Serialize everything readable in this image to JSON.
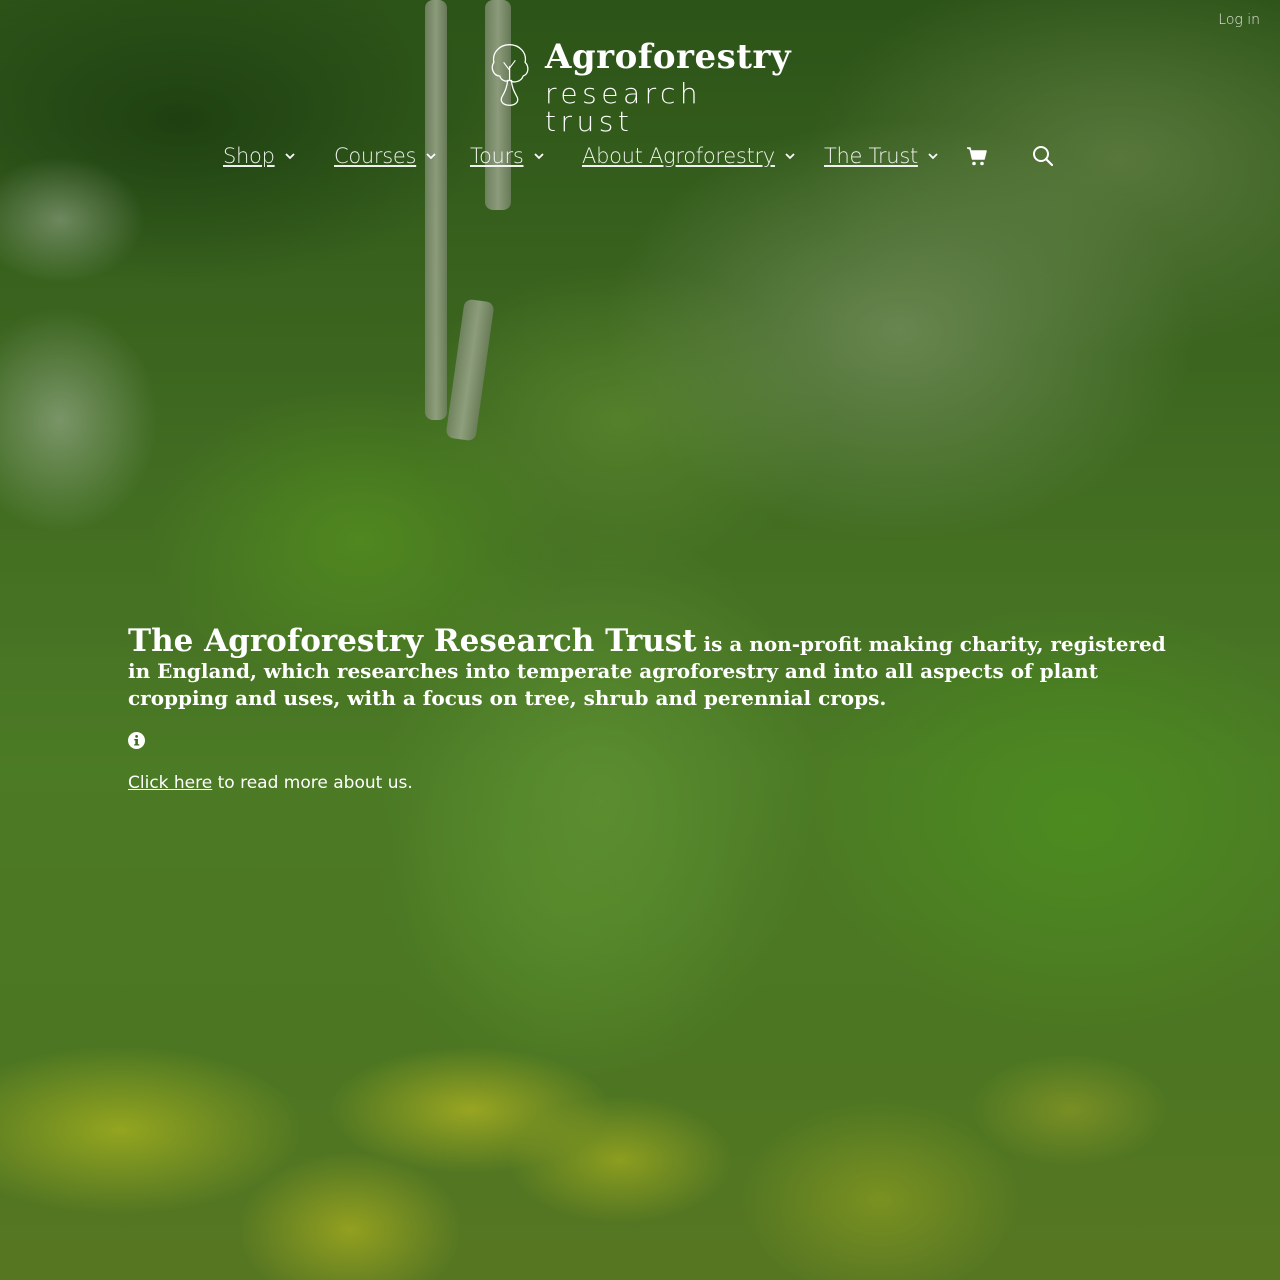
{
  "header": {
    "login_label": "Log in",
    "logo": {
      "title": "Agroforestry",
      "subtitle": "research trust",
      "icon": "tree-logo-icon"
    }
  },
  "nav": {
    "items": [
      {
        "label": "Shop",
        "has_dropdown": true
      },
      {
        "label": "Courses",
        "has_dropdown": true
      },
      {
        "label": "Tours",
        "has_dropdown": true
      },
      {
        "label": "About Agroforestry",
        "has_dropdown": true
      },
      {
        "label": "The Trust",
        "has_dropdown": true
      }
    ],
    "cart_icon": "shopping-cart-icon",
    "search_icon": "search-icon"
  },
  "intro": {
    "title": "The Agroforestry Research Trust",
    "body": " is a non-profit making charity, registered in England, which researches into temperate agroforestry and into all aspects of plant cropping and uses, with a focus on tree, shrub and perennial crops.",
    "info_icon": "info-circle-icon",
    "link_label": "Click here",
    "link_suffix": " to read more about us."
  },
  "colors": {
    "text": "#ffffff",
    "foliage": "#4a7a2a",
    "flowers": "#d4d628"
  }
}
